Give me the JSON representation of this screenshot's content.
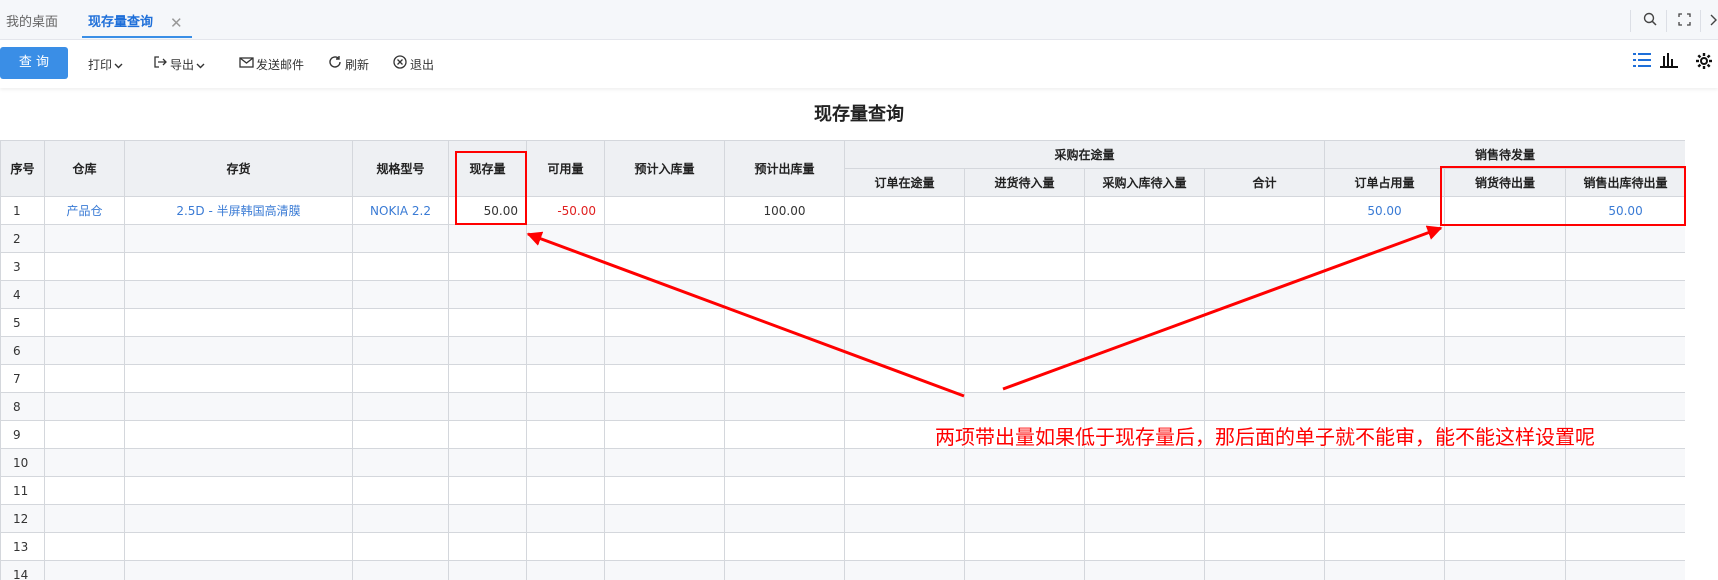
{
  "tabs": {
    "home_label": "我的桌面",
    "active_label": "现存量查询",
    "close_glyph": "✕"
  },
  "toolbar": {
    "query_label": "查 询",
    "print_label": "打印",
    "export_label": "导出",
    "send_mail_label": "发送邮件",
    "refresh_label": "刷新",
    "exit_label": "退出"
  },
  "title": "现存量查询",
  "table": {
    "headers": {
      "seq": "序号",
      "warehouse": "仓库",
      "inventory": "存货",
      "spec": "规格型号",
      "onhand": "现存量",
      "available": "可用量",
      "expected_in": "预计入库量",
      "expected_out": "预计出库量",
      "purchase_group": "采购在途量",
      "order_in_transit": "订单在途量",
      "pending_in": "进货待入量",
      "purchase_pending_in": "采购入库待入量",
      "total": "合计",
      "sales_group": "销售待发量",
      "order_occupied": "订单占用量",
      "sales_pending_out": "销货待出量",
      "sales_out_pending": "销售出库待出量"
    },
    "rows": [
      {
        "seq": "1",
        "warehouse": "产品仓",
        "inventory": "2.5D - 半屏韩国高清膜",
        "spec": "NOKIA 2.2",
        "onhand": "50.00",
        "available": "-50.00",
        "expected_in": "",
        "expected_out": "100.00",
        "order_in_transit": "",
        "pending_in": "",
        "purchase_pending_in": "",
        "total": "",
        "order_occupied": "50.00",
        "sales_pending_out": "",
        "sales_out_pending": "50.00"
      },
      {
        "seq": "2"
      },
      {
        "seq": "3"
      },
      {
        "seq": "4"
      },
      {
        "seq": "5"
      },
      {
        "seq": "6"
      },
      {
        "seq": "7"
      },
      {
        "seq": "8"
      },
      {
        "seq": "9"
      },
      {
        "seq": "10"
      },
      {
        "seq": "11"
      },
      {
        "seq": "12"
      },
      {
        "seq": "13"
      },
      {
        "seq": "14"
      }
    ]
  },
  "annotation": {
    "text": "两项带出量如果低于现存量后，那后面的单子就不能审，能不能这样设置呢"
  },
  "colors": {
    "accent": "#3a8ee6",
    "link": "#3a7bd5",
    "negative": "#e02020",
    "annotation": "#ff0000"
  },
  "icons": {
    "search": "search-icon",
    "fullscreen": "fullscreen-icon",
    "print_caret": "chevron-down-icon",
    "export": "export-icon",
    "mail": "mail-icon",
    "refresh": "refresh-icon",
    "exit": "exit-icon",
    "list_view": "list-view-icon",
    "chart_view": "bar-chart-icon",
    "settings": "gear-icon"
  }
}
